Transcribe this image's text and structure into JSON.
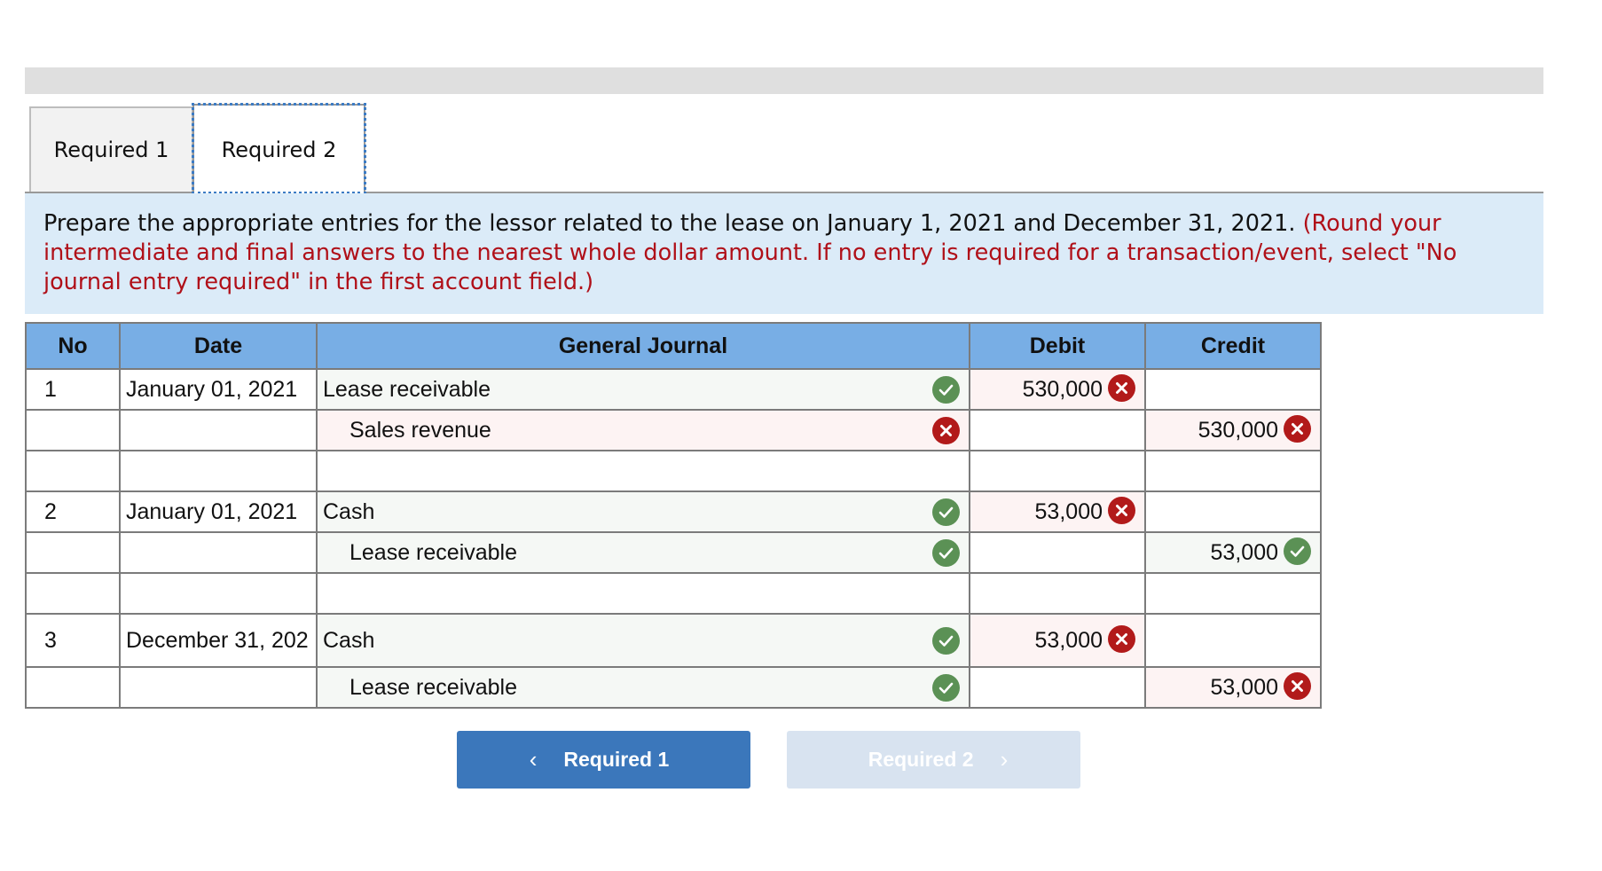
{
  "tabs": [
    {
      "label": "Required 1",
      "active": false
    },
    {
      "label": "Required 2",
      "active": true
    }
  ],
  "instructions": {
    "main": "Prepare the appropriate entries for the lessor related to the lease on January 1, 2021 and December 31, 2021. ",
    "note": "(Round your intermediate and final answers to the nearest whole dollar amount. If no entry is required for a transaction/event, select \"No journal entry required\" in the first account field.)"
  },
  "table": {
    "headers": {
      "no": "No",
      "date": "Date",
      "journal": "General Journal",
      "debit": "Debit",
      "credit": "Credit"
    },
    "rows": [
      {
        "no": "1",
        "date": "January 01, 2021",
        "account": "Lease receivable",
        "account_status": "correct",
        "debit": "530,000",
        "debit_status": "incorrect",
        "credit": "",
        "credit_status": ""
      },
      {
        "no": "",
        "date": "",
        "account": "Sales revenue",
        "account_status": "incorrect",
        "debit": "",
        "debit_status": "",
        "credit": "530,000",
        "credit_status": "incorrect"
      },
      {
        "no": "",
        "date": "",
        "account": "",
        "account_status": "",
        "debit": "",
        "debit_status": "",
        "credit": "",
        "credit_status": ""
      },
      {
        "no": "2",
        "date": "January 01, 2021",
        "account": "Cash",
        "account_status": "correct",
        "debit": "53,000",
        "debit_status": "incorrect",
        "credit": "",
        "credit_status": ""
      },
      {
        "no": "",
        "date": "",
        "account": "Lease receivable",
        "account_status": "correct",
        "debit": "",
        "debit_status": "",
        "credit": "53,000",
        "credit_status": "correct"
      },
      {
        "no": "",
        "date": "",
        "account": "",
        "account_status": "",
        "debit": "",
        "debit_status": "",
        "credit": "",
        "credit_status": ""
      },
      {
        "no": "3",
        "date": "December 31, 202",
        "account": "Cash",
        "account_status": "correct",
        "debit": "53,000",
        "debit_status": "incorrect",
        "credit": "",
        "credit_status": ""
      },
      {
        "no": "",
        "date": "",
        "account": "Lease receivable",
        "account_status": "correct",
        "debit": "",
        "debit_status": "",
        "credit": "53,000",
        "credit_status": "incorrect"
      }
    ]
  },
  "nav": {
    "prev_label": "Required 1",
    "prev_icon": "chevron-left-icon",
    "next_label": "Required 2",
    "next_icon": "chevron-right-icon",
    "next_disabled": true
  },
  "colors": {
    "header_bg": "#78aee5",
    "correct": "#5b9155",
    "incorrect": "#b21a1a",
    "instruction_note": "#b01019",
    "primary_button": "#3b77bb"
  }
}
